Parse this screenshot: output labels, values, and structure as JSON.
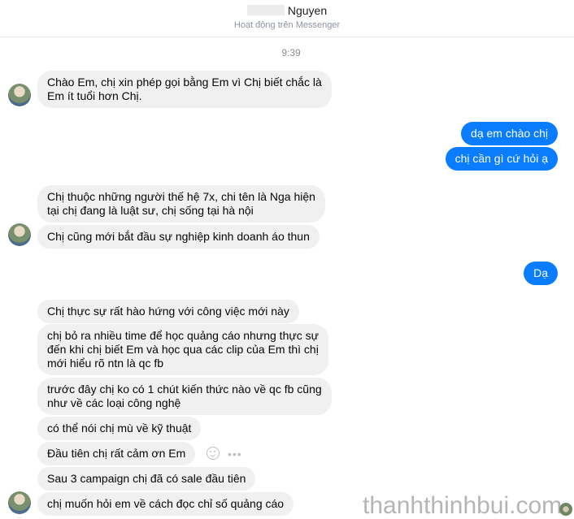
{
  "header": {
    "name": "Nguyen",
    "status": "Hoạt động trên Messenger"
  },
  "timestamp": "9:39",
  "messages": {
    "m1": [
      "Chào Em, chị xin phép gọi bằng Em vì Chị biết chắc là",
      "Em ít tuổi hơn Chị."
    ],
    "m2": "dạ em chào chị",
    "m3": "chị cần gì cứ hỏi ạ",
    "m4": [
      "Chị thuộc những người thế hệ 7x, chi tên là Nga hiện",
      "tại chị đang là luật sư, chị sống tại hà nội"
    ],
    "m5": "Chị cũng mới bắt đầu sự nghiệp kinh doanh áo thun",
    "m6": "Dạ",
    "m7": "Chị thực sự rất hào hứng với công việc mới này",
    "m8": [
      "chị bỏ ra nhiều time để học quảng cáo nhưng thực sự",
      "đến khi chị biết Em và học qua các clip của Em thì chị",
      "mới hiểu rõ ntn là qc fb"
    ],
    "m9": [
      "trước đây chị ko có 1 chút kiến thức nào về qc fb cũng",
      "như về các loại công nghệ"
    ],
    "m10": "có thể nói chị mù về kỹ thuật",
    "m11": "Đầu tiên chị rất cảm ơn Em",
    "m12": "Sau 3 campaign chị đã có sale đầu tiên",
    "m13": "chị muốn hỏi em về cách đọc chỉ số quảng cáo"
  },
  "watermark": "thanhthinhbui.com",
  "icons": [
    "avatar",
    "emoji-react-icon",
    "more-options-icon"
  ],
  "colors": {
    "outgoing": "#0a7cff",
    "incoming": "#f0f0f0"
  }
}
